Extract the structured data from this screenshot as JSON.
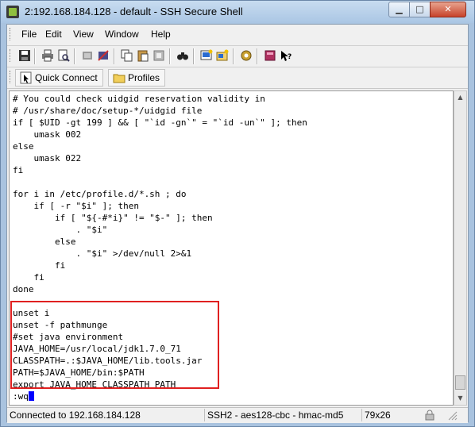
{
  "window": {
    "title": "2:192.168.184.128 - default - SSH Secure Shell",
    "minimize_glyph": "▁",
    "maximize_glyph": "□",
    "close_glyph": "✕"
  },
  "menu": [
    "File",
    "Edit",
    "View",
    "Window",
    "Help"
  ],
  "toolbar_icons": [
    "save-icon",
    "print-icon",
    "print-preview-icon",
    "disconnect-icon",
    "disconnect-all-icon",
    "copy-icon",
    "paste-icon",
    "paste-alt-icon",
    "find-icon",
    "new-terminal-icon",
    "new-file-transfer-icon",
    "settings-icon",
    "profiles-icon",
    "help-icon"
  ],
  "quickbar": {
    "quick_connect": "Quick Connect",
    "profiles": "Profiles"
  },
  "terminal_lines": [
    "# You could check uidgid reservation validity in",
    "# /usr/share/doc/setup-*/uidgid file",
    "if [ $UID -gt 199 ] && [ \"`id -gn`\" = \"`id -un`\" ]; then",
    "    umask 002",
    "else",
    "    umask 022",
    "fi",
    "",
    "for i in /etc/profile.d/*.sh ; do",
    "    if [ -r \"$i\" ]; then",
    "        if [ \"${-#*i}\" != \"$-\" ]; then",
    "            . \"$i\"",
    "        else",
    "            . \"$i\" >/dev/null 2>&1",
    "        fi",
    "    fi",
    "done",
    "",
    "unset i",
    "unset -f pathmunge",
    "#set java environment",
    "JAVA_HOME=/usr/local/jdk1.7.0_71",
    "CLASSPATH=.:$JAVA_HOME/lib.tools.jar",
    "PATH=$JAVA_HOME/bin:$PATH",
    "export JAVA_HOME CLASSPATH PATH"
  ],
  "command_line": ":wq",
  "status": {
    "connection": "Connected to 192.168.184.128",
    "cipher": "SSH2 - aes128-cbc - hmac-md5",
    "size": "79x26"
  },
  "colors": {
    "highlight_border": "#e02020",
    "cursor": "#0000ff",
    "title_bar": "#aac6e4"
  }
}
